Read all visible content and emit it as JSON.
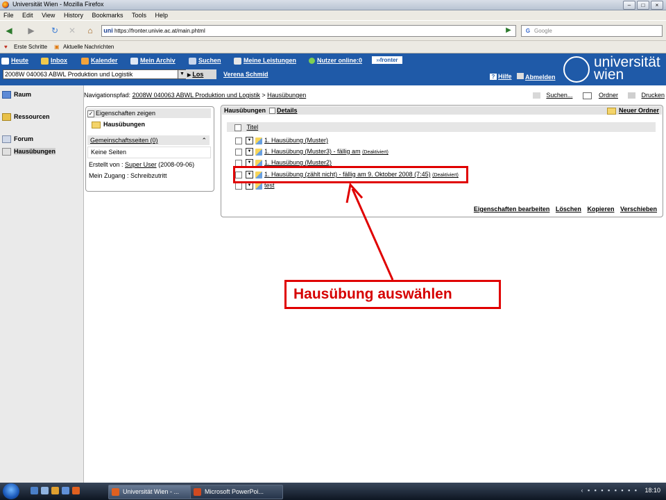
{
  "window": {
    "title": "Universität Wien - Mozilla Firefox"
  },
  "menu": [
    "File",
    "Edit",
    "View",
    "History",
    "Bookmarks",
    "Tools",
    "Help"
  ],
  "browser": {
    "url": "https://fronter.univie.ac.at/main.phtml",
    "url_badge": "uni",
    "search_placeholder": "Google"
  },
  "bookmarks": [
    "Erste Schritte",
    "Aktuelle Nachrichten"
  ],
  "fronter": {
    "nav": [
      "Heute",
      "Inbox",
      "Kalender",
      "Mein Archiv",
      "Suchen",
      "Meine Leistungen",
      "Nutzer online:0"
    ],
    "badge": "fronter",
    "course": "2008W 040063 ABWL Produktion und Logistik",
    "go": "Los",
    "user": "Verena Schmid",
    "help": "Hilfe",
    "logout": "Abmelden",
    "logo_line1": "universität",
    "logo_line2": "wien"
  },
  "sidebar": [
    "Raum",
    "Ressourcen",
    "Forum",
    "Hausübungen"
  ],
  "breadcrumb": {
    "prefix": "Navigationspfad:",
    "course": "2008W 040063 ABWL Produktion und Logistik",
    "sep": ">",
    "current": "Hausübungen"
  },
  "tools": [
    "Suchen...",
    "Ordner",
    "Drucken"
  ],
  "props": {
    "checkbox": "Eigenschaften zeigen",
    "folder": "Hausübungen",
    "shared": "Gemeinschaftsseiten (0)",
    "no_pages": "Keine Seiten",
    "created_prefix": "Erstellt von :",
    "created_user": "Super User",
    "created_date": "(2008-09-06)",
    "access": "Mein Zugang : Schreibzutritt"
  },
  "list": {
    "tab": "Hausübungen",
    "details": "Details",
    "new_folder": "Neuer Ordner",
    "column": "Titel",
    "rows": [
      {
        "title": "1. Hausübung (Muster)",
        "note": ""
      },
      {
        "title": "1. Hausübung (Muster3) - fällig am",
        "note": "(Deaktiviert)"
      },
      {
        "title": "1. Hausübung (Muster2)",
        "note": ""
      },
      {
        "title": "1. Hausübung (zählt nicht) - fällig am 9. Oktober 2008 (7:45)",
        "note": "(Deaktiviert)"
      },
      {
        "title": "test",
        "note": ""
      }
    ],
    "actions": [
      "Eigenschaften bearbeiten",
      "Löschen",
      "Kopieren",
      "Verschieben"
    ]
  },
  "annotation": {
    "text": "Hausübung auswählen",
    "color": "#e00000"
  },
  "taskbar": {
    "tasks": [
      "Universität Wien - ...",
      "Microsoft PowerPoi..."
    ],
    "clock": "18:10"
  },
  "colors": {
    "fronter_blue": "#1f5aa8",
    "annotation_red": "#e00000"
  }
}
